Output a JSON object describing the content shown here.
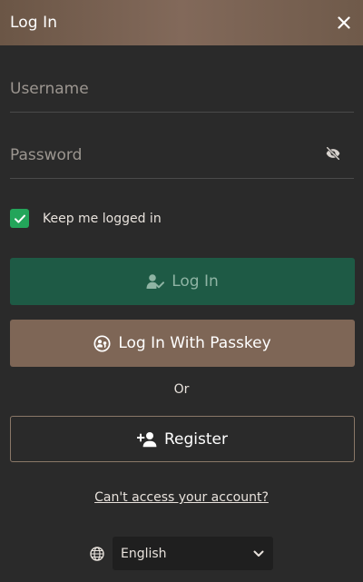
{
  "header": {
    "title": "Log In"
  },
  "form": {
    "username_placeholder": "Username",
    "password_placeholder": "Password",
    "remember_label": "Keep me logged in",
    "remember_checked": true
  },
  "buttons": {
    "login_label": "Log In",
    "passkey_label": "Log In With Passkey",
    "or_text": "Or",
    "register_label": "Register"
  },
  "links": {
    "cant_access": "Can't access your account?"
  },
  "language": {
    "selected": "English"
  },
  "colors": {
    "login_bg": "#1e5a45",
    "passkey_bg": "#7e6656",
    "checkbox": "#23a55a",
    "background": "#2a2a2a"
  },
  "icons": {
    "close": "close-icon",
    "eye_toggle": "eye-slash-icon",
    "login": "user-check-icon",
    "passkey": "passkey-icon",
    "register": "user-plus-icon",
    "language": "globe-icon",
    "dropdown": "chevron-down-icon"
  }
}
